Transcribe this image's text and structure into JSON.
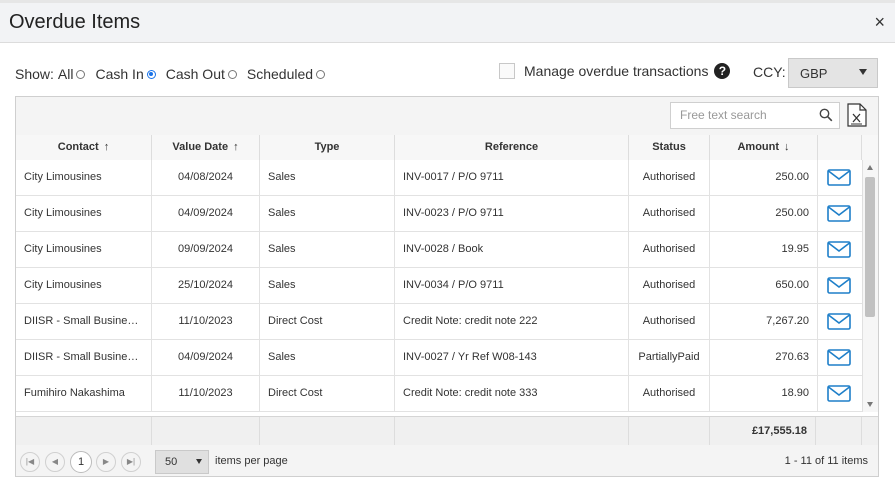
{
  "dialog": {
    "title": "Overdue Items",
    "close_glyph": "×"
  },
  "filters": {
    "show_label": "Show:",
    "options": [
      {
        "label": "All",
        "selected": false
      },
      {
        "label": "Cash In",
        "selected": true
      },
      {
        "label": "Cash Out",
        "selected": false
      },
      {
        "label": "Scheduled",
        "selected": false
      }
    ]
  },
  "manage": {
    "label": "Manage overdue transactions",
    "checked": false,
    "help_glyph": "?"
  },
  "ccy": {
    "label": "CCY:",
    "value": "GBP"
  },
  "search": {
    "placeholder": "Free text search"
  },
  "columns": [
    "Contact",
    "Value Date",
    "Type",
    "Reference",
    "Status",
    "Amount"
  ],
  "sort": {
    "contact": "↑",
    "value_date": "↑",
    "amount": "↓"
  },
  "rows": [
    {
      "contact": "City Limousines",
      "value_date": "04/08/2024",
      "type": "Sales",
      "reference": "INV-0017 / P/O 9711",
      "status": "Authorised",
      "amount": "250.00"
    },
    {
      "contact": "City Limousines",
      "value_date": "04/09/2024",
      "type": "Sales",
      "reference": "INV-0023 / P/O 9711",
      "status": "Authorised",
      "amount": "250.00"
    },
    {
      "contact": "City Limousines",
      "value_date": "09/09/2024",
      "type": "Sales",
      "reference": "INV-0028 / Book",
      "status": "Authorised",
      "amount": "19.95"
    },
    {
      "contact": "City Limousines",
      "value_date": "25/10/2024",
      "type": "Sales",
      "reference": "INV-0034 / P/O 9711",
      "status": "Authorised",
      "amount": "650.00"
    },
    {
      "contact": "DIISR - Small Business ...",
      "value_date": "11/10/2023",
      "type": "Direct Cost",
      "reference": "Credit Note: credit note 222",
      "status": "Authorised",
      "amount": "7,267.20"
    },
    {
      "contact": "DIISR - Small Business ...",
      "value_date": "04/09/2024",
      "type": "Sales",
      "reference": "INV-0027 / Yr Ref W08-143",
      "status": "PartiallyPaid",
      "amount": "270.63"
    },
    {
      "contact": "Fumihiro Nakashima",
      "value_date": "11/10/2023",
      "type": "Direct Cost",
      "reference": "Credit Note: credit note 333",
      "status": "Authorised",
      "amount": "18.90"
    }
  ],
  "footer": {
    "total": "£17,555.18"
  },
  "pager": {
    "current_page": "1",
    "page_size": "50",
    "items_per_page_label": "items per page",
    "info": "1 - 11 of 11 items"
  },
  "colors": {
    "accent": "#1a73e8",
    "mail_icon": "#1e7fc9"
  },
  "icons": [
    "close-icon",
    "help-icon",
    "chevron-down-icon",
    "search-icon",
    "excel-export-icon",
    "mail-icon",
    "first-page-icon",
    "prev-page-icon",
    "next-page-icon",
    "last-page-icon"
  ]
}
